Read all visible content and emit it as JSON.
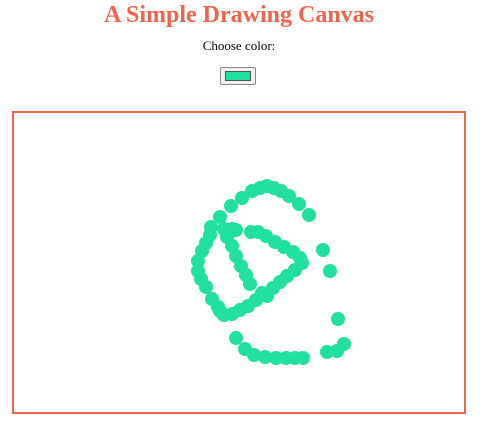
{
  "page": {
    "title": "A Simple Drawing Canvas",
    "color_label": "Choose color:"
  },
  "color_picker": {
    "value": "#20e0a0"
  },
  "colors": {
    "accent": "#f0644c",
    "stroke": "#20e0a0"
  }
}
